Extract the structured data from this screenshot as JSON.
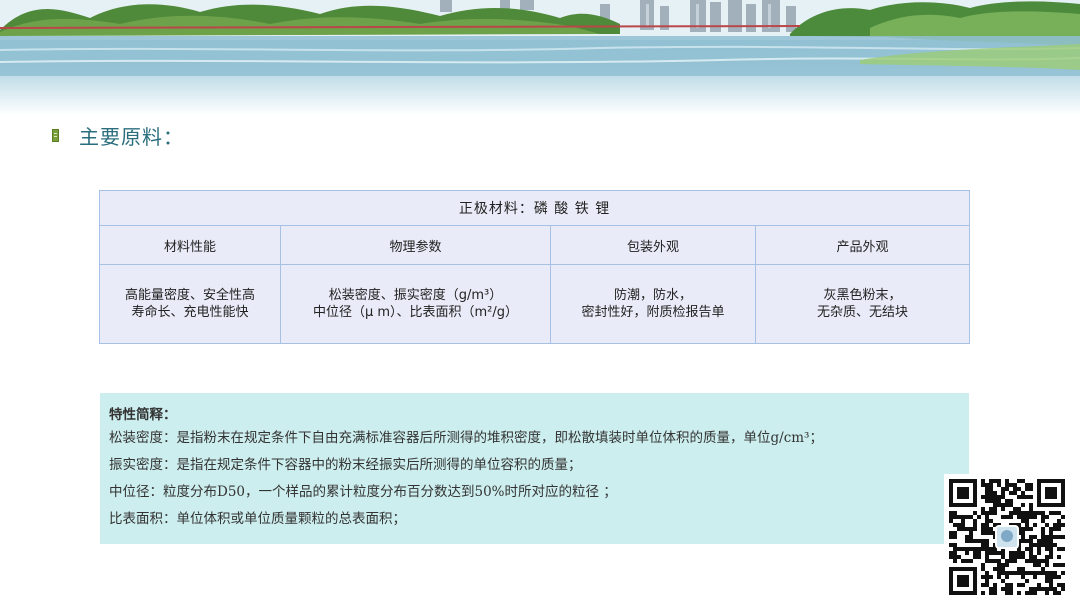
{
  "page": {
    "title": "主要原料："
  },
  "table": {
    "header": "正极材料：磷 酸 铁 锂",
    "columns": [
      "材料性能",
      "物理参数",
      "包装外观",
      "产品外观"
    ],
    "row": {
      "performance_line1": "高能量密度、安全性高",
      "performance_line2": "寿命长、充电性能快",
      "physical_line1": "松装密度、振实密度（g/m³）",
      "physical_line2": "中位径（μ m）、比表面积（m²/g）",
      "packaging_line1": "防潮，防水，",
      "packaging_line2": "密封性好，附质检报告单",
      "appearance_line1": "灰黑色粉末，",
      "appearance_line2": "无杂质、无结块"
    }
  },
  "notes": {
    "heading": "特性简释：",
    "lines": [
      "松装密度：是指粉末在规定条件下自由充满标准容器后所测得的堆积密度，即松散填装时单位体积的质量，单位g/cm³；",
      "振实密度：是指在规定条件下容器中的粉末经振实后所测得的单位容积的质量；",
      "中位径：粒度分布D50，一个样品的累计粒度分布百分数达到50%时所对应的粒径 ；",
      "比表面积：单位体积或单位质量颗粒的总表面积；"
    ]
  },
  "colors": {
    "title": "#2a6e7d",
    "table_bg": "#e9ecf8",
    "table_border": "#a6c1e3",
    "note_bg": "#cdeeee",
    "bullet": "#7a9e3a"
  },
  "icons": {
    "title_bullet": "document-bullet-icon",
    "qr": "qr-code-icon"
  }
}
